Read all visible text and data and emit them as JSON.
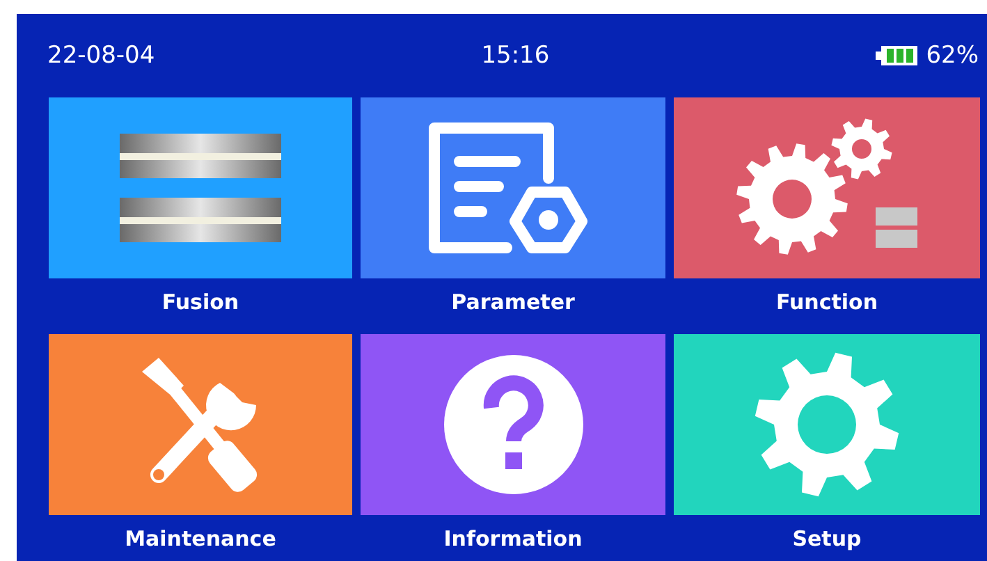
{
  "status_bar": {
    "date": "22-08-04",
    "time": "15:16",
    "battery": "62%"
  },
  "tiles": [
    {
      "label": "Fusion",
      "kind": "fusion",
      "color": "#20a0ff"
    },
    {
      "label": "Parameter",
      "kind": "parameter",
      "color": "#3f7cf6"
    },
    {
      "label": "Function",
      "kind": "function",
      "color": "#dc5a6a"
    },
    {
      "label": "Maintenance",
      "kind": "maintenance",
      "color": "#f7823a"
    },
    {
      "label": "Information",
      "kind": "information",
      "color": "#8f55f5"
    },
    {
      "label": "Setup",
      "kind": "setup",
      "color": "#22d5bd"
    }
  ]
}
